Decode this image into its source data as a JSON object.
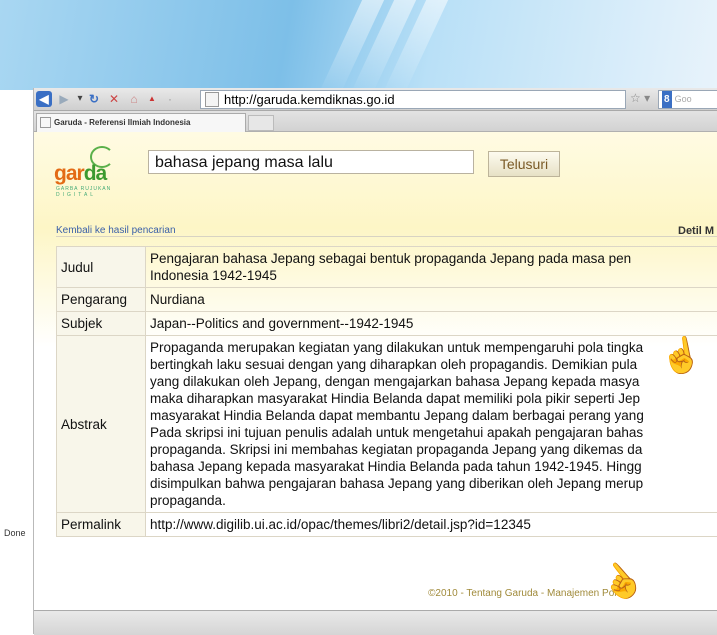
{
  "browser": {
    "url": "http://garuda.kemdiknas.go.id",
    "tab_title": "Garuda - Referensi Ilmiah Indonesia",
    "status": "Done",
    "search_engine": "Goo"
  },
  "search": {
    "query": "bahasa jepang masa lalu",
    "button": "Telusuri"
  },
  "logo": {
    "name_a": "gar",
    "name_b": "da",
    "tagline": "GARBA RUJUKAN",
    "tagline2": "DIGITAL"
  },
  "nav": {
    "back_link": "Kembali ke hasil pencarian",
    "detail": "Detil M"
  },
  "record": {
    "judul_label": "Judul",
    "judul_line1": "Pengajaran bahasa Jepang sebagai bentuk propaganda Jepang pada masa pen",
    "judul_line2": "Indonesia 1942-1945",
    "pengarang_label": "Pengarang",
    "pengarang": "Nurdiana",
    "subjek_label": "Subjek",
    "subjek": "Japan--Politics and government--1942-1945",
    "abstrak_label": "Abstrak",
    "abstrak_lines": [
      "Propaganda merupakan kegiatan yang dilakukan untuk mempengaruhi pola tingka",
      "bertingkah laku sesuai dengan yang diharapkan oleh propagandis. Demikian pula",
      "yang dilakukan oleh Jepang, dengan mengajarkan bahasa Jepang kepada masya",
      "maka diharapkan masyarakat Hindia Belanda dapat memiliki pola pikir seperti Jep",
      "masyarakat Hindia Belanda dapat membantu Jepang dalam berbagai perang yang",
      "Pada skripsi ini tujuan penulis adalah untuk mengetahui apakah pengajaran bahas",
      "propaganda. Skripsi ini membahas kegiatan propaganda Jepang yang dikemas da",
      "bahasa Jepang kepada masyarakat Hindia Belanda pada tahun 1942-1945. Hingg",
      "disimpulkan bahwa pengajaran bahasa Jepang yang diberikan oleh Jepang merup",
      "propaganda."
    ],
    "permalink_label": "Permalink",
    "permalink": "http://www.digilib.ui.ac.id/opac/themes/libri2/detail.jsp?id=12345"
  },
  "footer": {
    "text": "©2010 - Tentang Garuda - Manajemen Porta"
  },
  "colors": {
    "link_green": "#3a9a22",
    "link_blue": "#3a5fa8",
    "footer_text": "#a08a3a"
  }
}
